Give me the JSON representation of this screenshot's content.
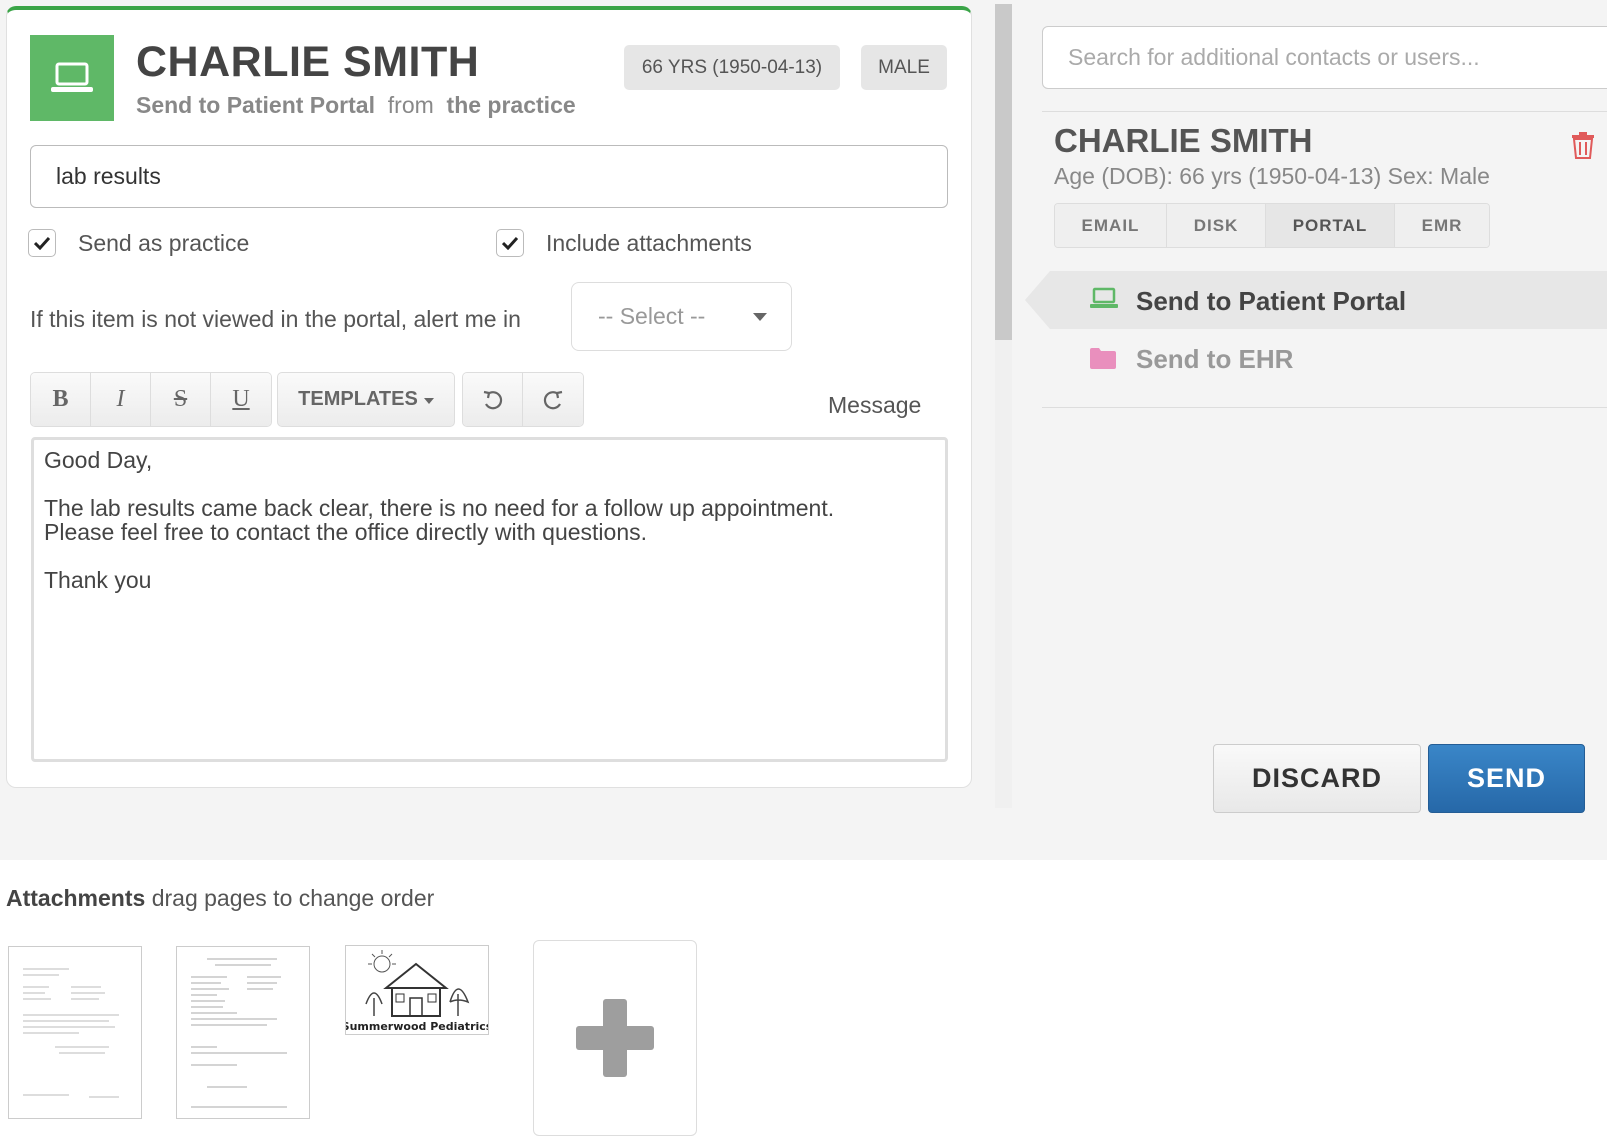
{
  "patient": {
    "name": "CHARLIE SMITH",
    "subtitle_action": "Send to Patient Portal",
    "subtitle_from": "from",
    "subtitle_source": "the practice",
    "age_badge": "66 YRS (1950-04-13)",
    "sex_badge": "MALE"
  },
  "form": {
    "subject_value": "lab results",
    "send_as_practice_label": "Send as practice",
    "send_as_practice_checked": true,
    "include_attachments_label": "Include attachments",
    "include_attachments_checked": true,
    "alert_label": "If this item is not viewed in the portal, alert me in",
    "alert_select_value": "-- Select --"
  },
  "toolbar": {
    "bold": "B",
    "italic": "I",
    "strike": "S",
    "underline": "U",
    "templates": "TEMPLATES",
    "message_label": "Message"
  },
  "message": {
    "line1": "Good Day,",
    "line2": "The lab results came back clear, there is no need for a follow up appointment.",
    "line3": "Please feel free to contact the office directly with questions.",
    "line4": "Thank you"
  },
  "recipients": {
    "search_placeholder": "Search for additional contacts or users...",
    "contact_name": "CHARLIE SMITH",
    "contact_info": "Age (DOB): 66 yrs (1950-04-13) Sex: Male",
    "tabs": [
      {
        "label": "EMAIL",
        "active": false
      },
      {
        "label": "DISK",
        "active": false
      },
      {
        "label": "PORTAL",
        "active": true
      },
      {
        "label": "EMR",
        "active": false
      }
    ],
    "options": [
      {
        "label": "Send to Patient Portal",
        "icon": "laptop-icon",
        "selected": true
      },
      {
        "label": "Send to EHR",
        "icon": "folder-icon",
        "selected": false
      }
    ]
  },
  "actions": {
    "discard": "DISCARD",
    "send": "SEND"
  },
  "attachments": {
    "title": "Attachments",
    "hint": "drag pages to change order",
    "logo_text": "Summerwood Pediatrics"
  },
  "colors": {
    "brand_green": "#5fb867",
    "send_blue": "#2f78bd",
    "trash_red": "#e05a5a",
    "folder_pink": "#e98fbd"
  }
}
